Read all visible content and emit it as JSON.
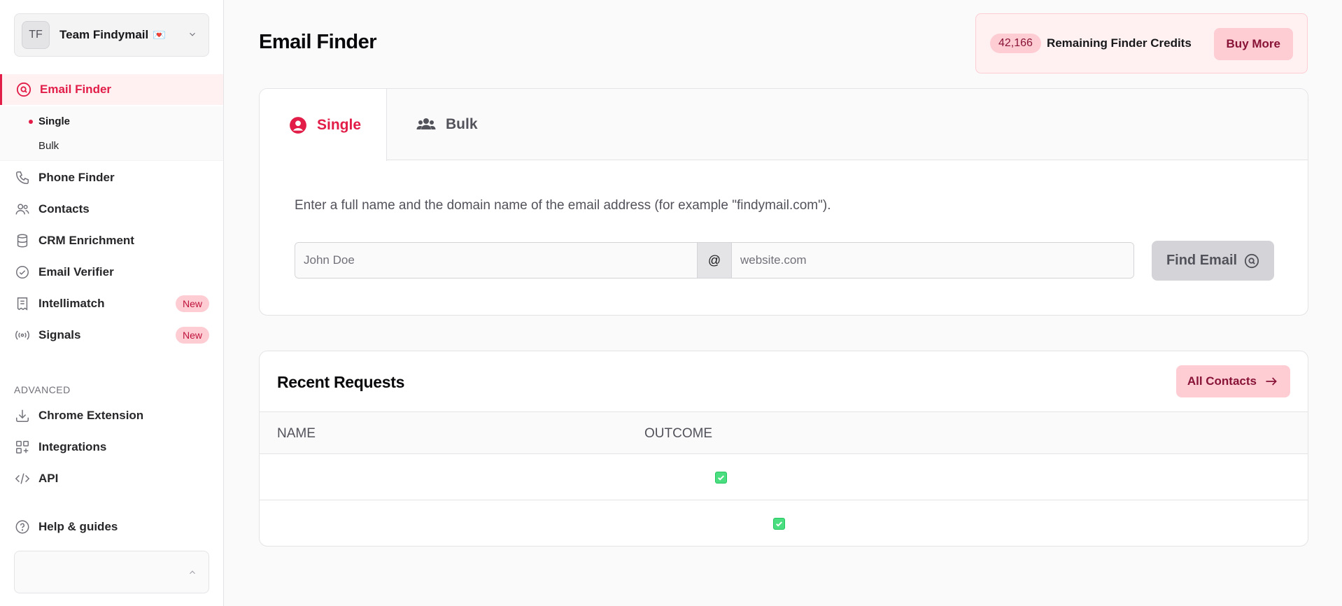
{
  "sidebar": {
    "team": {
      "initials": "TF",
      "name": "Team Findymail",
      "emoji": "💌"
    },
    "email_finder": {
      "label": "Email Finder",
      "sub_items": [
        {
          "label": "Single",
          "active": true
        },
        {
          "label": "Bulk",
          "active": false
        }
      ]
    },
    "items": [
      {
        "label": "Phone Finder",
        "icon": "phone-icon"
      },
      {
        "label": "Contacts",
        "icon": "users-icon"
      },
      {
        "label": "CRM Enrichment",
        "icon": "database-icon"
      },
      {
        "label": "Email Verifier",
        "icon": "check-circle-icon"
      },
      {
        "label": "Intellimatch",
        "icon": "document-icon",
        "badge": "New"
      },
      {
        "label": "Signals",
        "icon": "signal-icon",
        "badge": "New"
      }
    ],
    "advanced_label": "ADVANCED",
    "advanced_items": [
      {
        "label": "Chrome Extension",
        "icon": "download-icon"
      },
      {
        "label": "Integrations",
        "icon": "grid-plus-icon"
      },
      {
        "label": "API",
        "icon": "code-icon"
      }
    ],
    "help": {
      "label": "Help & guides",
      "icon": "question-icon"
    }
  },
  "header": {
    "title": "Email Finder",
    "credits": {
      "count": "42,166",
      "label": "Remaining Finder Credits",
      "buy_label": "Buy More"
    }
  },
  "finder": {
    "tabs": [
      {
        "label": "Single",
        "active": true
      },
      {
        "label": "Bulk",
        "active": false
      }
    ],
    "instructions": "Enter a full name and the domain name of the email address (for example \"findymail.com\").",
    "name_placeholder": "John Doe",
    "at_symbol": "@",
    "domain_placeholder": "website.com",
    "find_label": "Find Email"
  },
  "recent": {
    "title": "Recent Requests",
    "all_contacts_label": "All Contacts",
    "columns": [
      "NAME",
      "OUTCOME"
    ],
    "rows": [
      {
        "name": "",
        "outcome": "found"
      },
      {
        "name": "",
        "outcome": "found"
      }
    ]
  },
  "colors": {
    "accent": "#e11d48",
    "accent_light": "#fecdd3",
    "success": "#4ade80"
  }
}
